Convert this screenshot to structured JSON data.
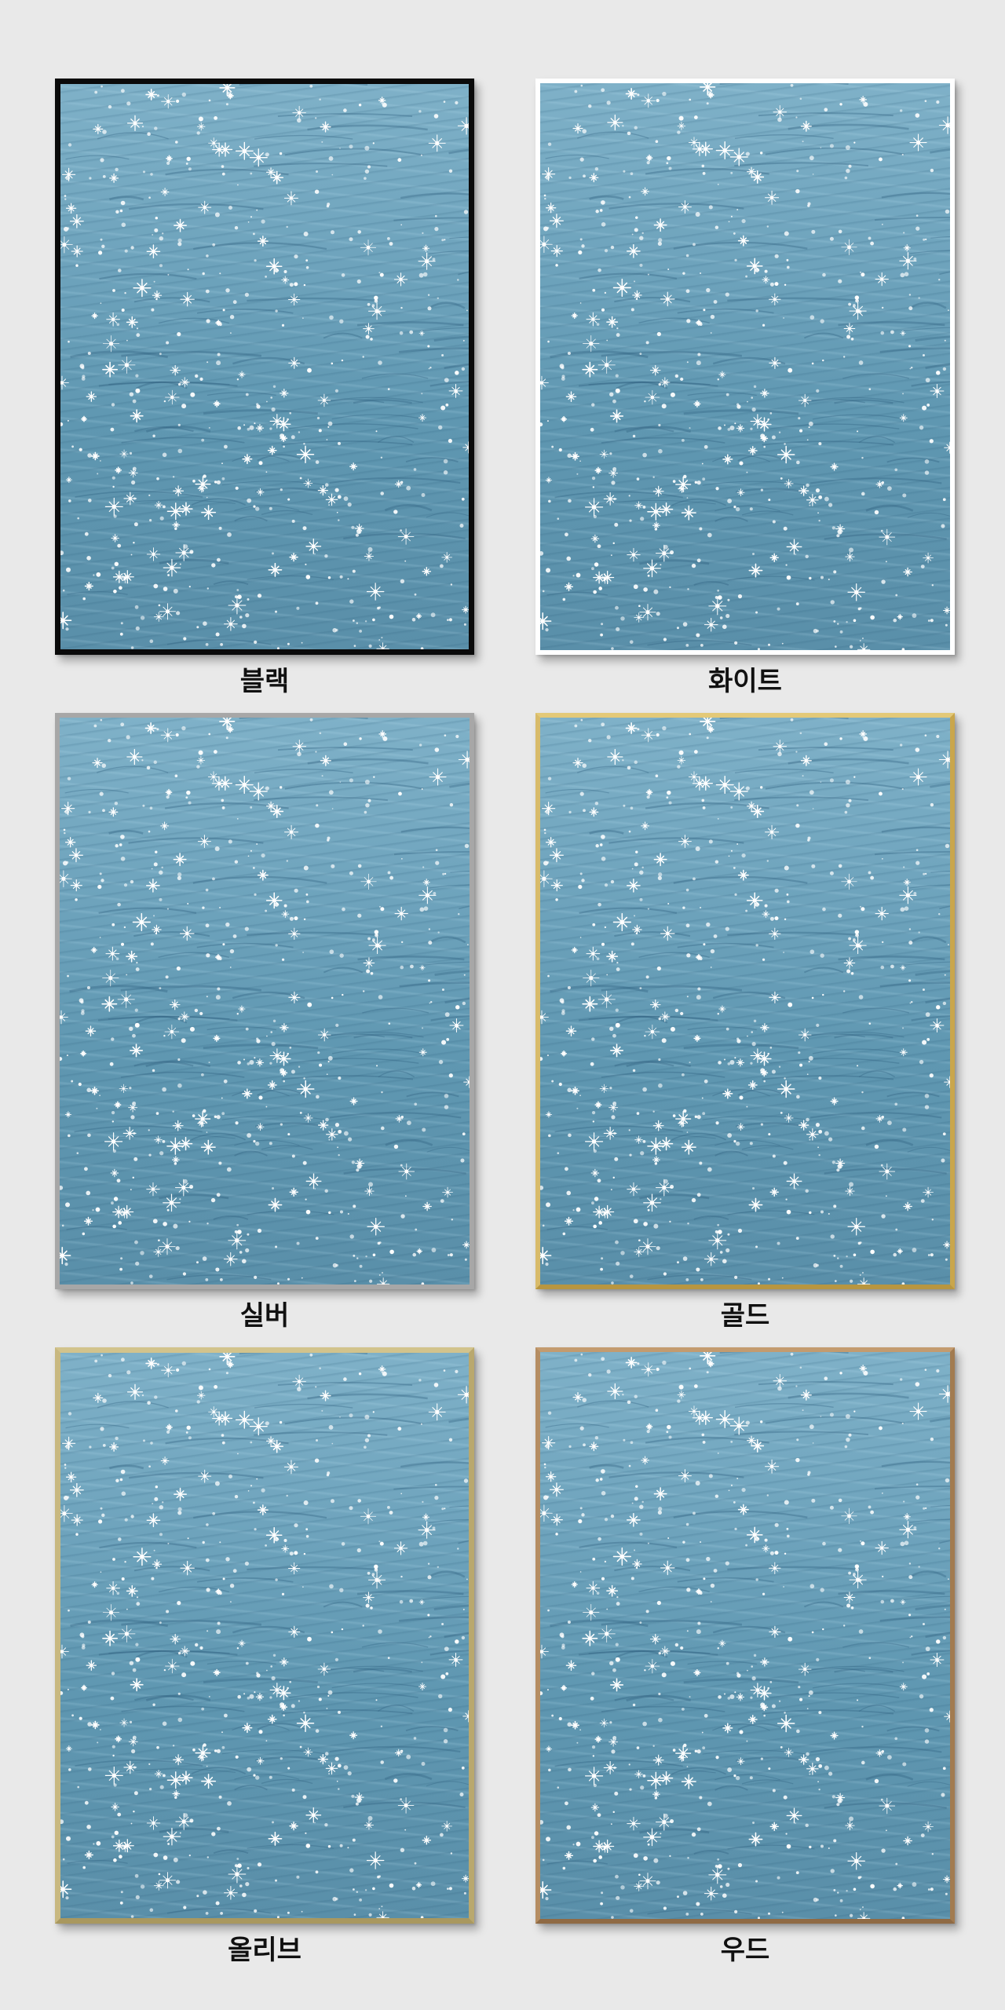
{
  "frames": [
    {
      "id": "black",
      "label": "블랙",
      "color": "#0a0a0a"
    },
    {
      "id": "white",
      "label": "화이트",
      "color": "#ffffff"
    },
    {
      "id": "silver",
      "label": "실버",
      "color": "#a7a7a7"
    },
    {
      "id": "gold",
      "label": "골드",
      "color": "#d1b35e"
    },
    {
      "id": "olive",
      "label": "올리브",
      "color": "#c2b27a"
    },
    {
      "id": "wood",
      "label": "우드",
      "color": "#b0885c"
    }
  ],
  "colors": {
    "background": "#e9e9e9",
    "water": "#6fa4bd",
    "sparkle": "#ffffff"
  },
  "artwork_subject": "sparkling-water-icon"
}
